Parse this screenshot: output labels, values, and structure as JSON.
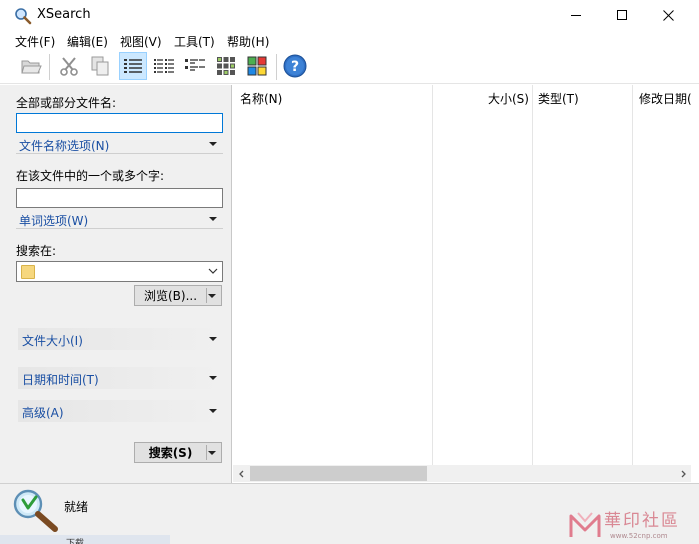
{
  "window": {
    "title": "XSearch",
    "app_icon": "magnifier-icon",
    "controls": [
      "minimize-icon",
      "maximize-icon",
      "close-icon"
    ]
  },
  "menu": [
    {
      "label": "文件(F)"
    },
    {
      "label": "编辑(E)"
    },
    {
      "label": "视图(V)"
    },
    {
      "label": "工具(T)"
    },
    {
      "label": "帮助(H)"
    }
  ],
  "toolbar": {
    "buttons": [
      "open-folder-icon",
      "cut-icon",
      "copy-icon",
      "details-view-icon",
      "list-view-icon",
      "small-icons-view-icon",
      "thumbnails-view-icon",
      "large-icons-view-icon",
      "help-icon"
    ],
    "active": "details-view-icon"
  },
  "search": {
    "filename_label": "全部或部分文件名:",
    "filename_value": "",
    "filename_options": "文件名称选项(N)",
    "words_label": "在该文件中的一个或多个字:",
    "words_value": "",
    "words_options": "单词选项(W)",
    "look_in_label": "搜索在:",
    "look_in_value": "",
    "browse_button": "浏览(B)...",
    "size_section": "文件大小(I)",
    "date_section": "日期和时间(T)",
    "advanced_section": "高级(A)",
    "search_button": "搜索(S)"
  },
  "results": {
    "columns": [
      "名称(N)",
      "大小(S)",
      "类型(T)",
      "修改日期("
    ],
    "rows": []
  },
  "status": {
    "text": "就绪"
  },
  "watermark": {
    "text": "華印社區",
    "url": "www.52cnp.com"
  },
  "background_peek": "下载",
  "colors": {
    "link_blue": "#1a4fa3",
    "panel_bg": "#f0f0f0",
    "selected_bg": "#cce8ff",
    "focus_border": "#0078d7"
  }
}
